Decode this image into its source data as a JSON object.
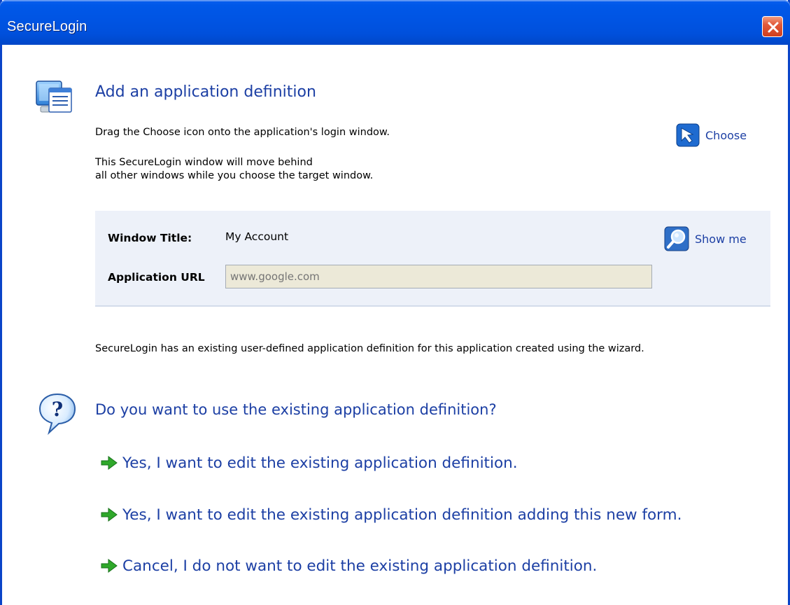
{
  "window": {
    "title": "SecureLogin",
    "close_icon": "close-icon"
  },
  "header": {
    "icon": "application-window-icon",
    "title": "Add an application definition",
    "instruction": "Drag the Choose icon onto the application's login window.",
    "note_line1": "This SecureLogin window will move behind",
    "note_line2": "all other windows while you choose the target window."
  },
  "choose": {
    "icon": "choose-cursor-icon",
    "label": "Choose"
  },
  "panel": {
    "window_title_label": "Window Title:",
    "window_title_value": "My Account",
    "app_url_label": "Application URL",
    "app_url_placeholder": "www.google.com",
    "show_me_icon": "magnifier-icon",
    "show_me_label": "Show me"
  },
  "existing_message": "SecureLogin has an existing user-defined application definition for this application created using the wizard.",
  "question": {
    "icon": "question-icon",
    "text": "Do you want to use the existing application definition?"
  },
  "options": [
    {
      "icon": "green-arrow-icon",
      "label": "Yes, I want to edit the existing application definition."
    },
    {
      "icon": "green-arrow-icon",
      "label": "Yes, I want to edit the existing application definition adding this new form."
    },
    {
      "icon": "green-arrow-icon",
      "label": "Cancel, I do not want to edit the existing application definition."
    }
  ],
  "colors": {
    "title_bar": "#0054e3",
    "link_blue": "#1c3fa4",
    "panel_bg": "#edf1f9",
    "arrow_green": "#2fa82a",
    "close_red": "#d13e1d"
  }
}
